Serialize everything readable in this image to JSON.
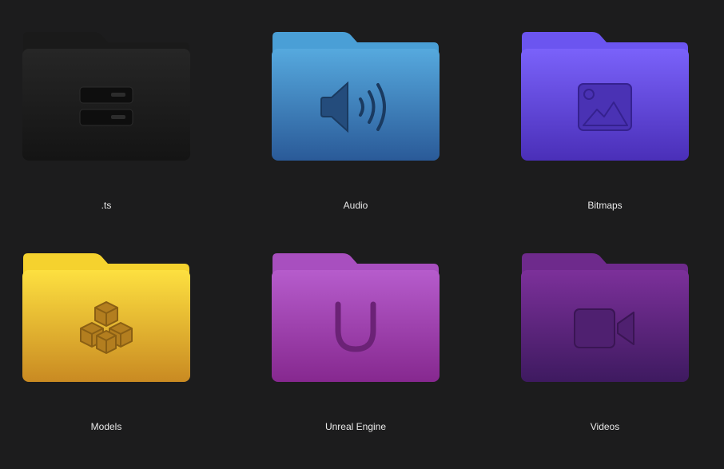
{
  "folders": [
    {
      "name": ".ts",
      "icon": "server-icon",
      "colors": {
        "tab": "#1a1a1a",
        "front_top": "#262626",
        "front_bottom": "#141414",
        "glyph": "#0e0e0e"
      }
    },
    {
      "name": "Audio",
      "icon": "speaker-icon",
      "colors": {
        "tab": "#4a9fd6",
        "front_top": "#56a9de",
        "front_bottom": "#2a5a98",
        "glyph": "#1e3f66"
      }
    },
    {
      "name": "Bitmaps",
      "icon": "image-icon",
      "colors": {
        "tab": "#6b55f0",
        "front_top": "#7a62fa",
        "front_bottom": "#4a2fb8",
        "glyph": "#3a2690"
      }
    },
    {
      "name": "Models",
      "icon": "cubes-icon",
      "colors": {
        "tab": "#f5d22e",
        "front_top": "#fde040",
        "front_bottom": "#c98a22",
        "glyph": "#a8761c"
      }
    },
    {
      "name": "Unreal Engine",
      "icon": "unreal-u-icon",
      "colors": {
        "tab": "#a84fbf",
        "front_top": "#b65ccc",
        "front_bottom": "#86288f",
        "glyph": "#6b2276"
      }
    },
    {
      "name": "Videos",
      "icon": "video-camera-icon",
      "colors": {
        "tab": "#6e2a8c",
        "front_top": "#7c309a",
        "front_bottom": "#3e1a60",
        "glyph": "#421c5e"
      }
    }
  ]
}
